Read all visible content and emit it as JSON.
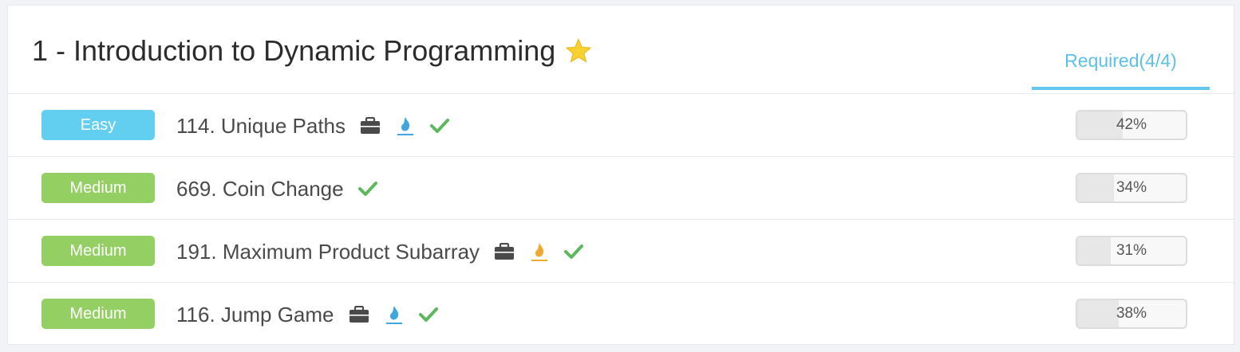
{
  "section": {
    "title": "1 - Introduction to Dynamic Programming",
    "tab_label": "Required(4/4)",
    "tab_color": "#5bc0ea"
  },
  "problems": [
    {
      "difficulty": "Easy",
      "difficulty_color": "#62cff0",
      "title": "114. Unique Paths",
      "icons": [
        "briefcase-icon",
        "flame-blue-icon",
        "checkmark-icon"
      ],
      "progress_label": "42%",
      "progress": 0.42
    },
    {
      "difficulty": "Medium",
      "difficulty_color": "#93cf62",
      "title": "669. Coin Change",
      "icons": [
        "checkmark-icon"
      ],
      "progress_label": "34%",
      "progress": 0.34
    },
    {
      "difficulty": "Medium",
      "difficulty_color": "#93cf62",
      "title": "191. Maximum Product Subarray",
      "icons": [
        "briefcase-icon",
        "flame-orange-icon",
        "checkmark-icon"
      ],
      "progress_label": "31%",
      "progress": 0.31
    },
    {
      "difficulty": "Medium",
      "difficulty_color": "#93cf62",
      "title": "116. Jump Game",
      "icons": [
        "briefcase-icon",
        "flame-blue-icon",
        "checkmark-icon"
      ],
      "progress_label": "38%",
      "progress": 0.38
    }
  ]
}
